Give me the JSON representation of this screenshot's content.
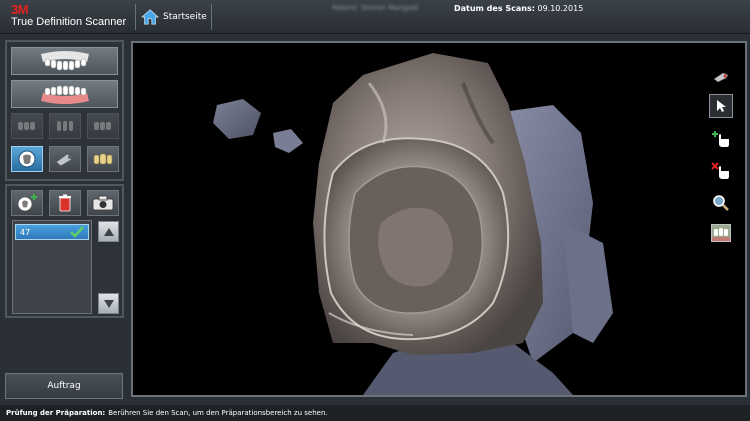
{
  "app": {
    "brand_logo": "3M",
    "brand_name": "True Definition Scanner"
  },
  "header": {
    "home_label": "Startseite",
    "patient_text": "Patient: Steiner Mangold",
    "scan_date_label": "Datum des Scans:",
    "scan_date_value": "09.10.2015"
  },
  "scan_list": {
    "items": [
      {
        "label": "47",
        "selected": true
      }
    ]
  },
  "sidebar": {
    "order_button": "Auftrag"
  },
  "status": {
    "title": "Prüfung der Präparation:",
    "message": "Berühren Sie den Scan, um den Präparationsbereich zu sehen."
  },
  "colors": {
    "brand_red": "#e0231b",
    "accent_blue": "#3d8fd0",
    "check_green": "#3bb54a",
    "viewport_bg": "#000000"
  },
  "icons": {
    "home": "home-icon",
    "upper_jaw": "upper-jaw-icon",
    "lower_jaw": "lower-jaw-icon",
    "check": "check-icon",
    "trash": "trash-icon",
    "camera": "camera-icon",
    "add_scan": "add-scan-icon",
    "magnifier": "magnifier-icon",
    "pointer": "pointer-icon"
  }
}
